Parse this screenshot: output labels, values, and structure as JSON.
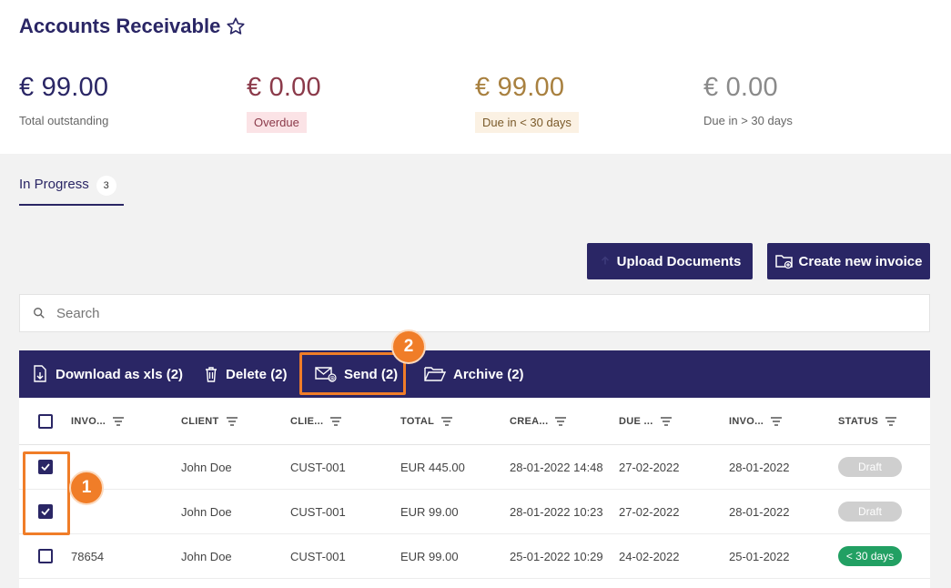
{
  "page": {
    "title": "Accounts Receivable"
  },
  "stats": [
    {
      "amount": "€ 99.00",
      "label": "Total outstanding",
      "color": "#2a2665"
    },
    {
      "amount": "€ 0.00",
      "label": "Overdue",
      "color": "#8b3a4a",
      "badge_bg": "#fbe3e6"
    },
    {
      "amount": "€ 99.00",
      "label": "Due in < 30 days",
      "color": "#a8803f",
      "badge_bg": "#fbf1e3"
    },
    {
      "amount": "€ 0.00",
      "label": "Due in > 30 days",
      "color": "#8a8a8a"
    }
  ],
  "tabs": [
    {
      "label": "In Progress",
      "count": "3"
    }
  ],
  "buttons": {
    "upload": "Upload Documents",
    "create": "Create new invoice"
  },
  "search": {
    "placeholder": "Search"
  },
  "actions": {
    "download": "Download as xls (2)",
    "delete": "Delete (2)",
    "send": "Send (2)",
    "archive": "Archive (2)"
  },
  "table": {
    "headers": [
      "INVO...",
      "CLIENT",
      "CLIE...",
      "TOTAL",
      "CREA...",
      "DUE ...",
      "INVO...",
      "STATUS"
    ],
    "rows": [
      {
        "checked": true,
        "invoice": "",
        "client": "John Doe",
        "client_id": "CUST-001",
        "total": "EUR 445.00",
        "created": "28-01-2022 14:48",
        "due": "27-02-2022",
        "invoice_date": "28-01-2022",
        "status": "Draft",
        "status_color": "#cfcfcf"
      },
      {
        "checked": true,
        "invoice": "",
        "client": "John Doe",
        "client_id": "CUST-001",
        "total": "EUR 99.00",
        "created": "28-01-2022 10:23",
        "due": "27-02-2022",
        "invoice_date": "28-01-2022",
        "status": "Draft",
        "status_color": "#cfcfcf"
      },
      {
        "checked": false,
        "invoice": "78654",
        "client": "John Doe",
        "client_id": "CUST-001",
        "total": "EUR 99.00",
        "created": "25-01-2022 10:29",
        "due": "24-02-2022",
        "invoice_date": "25-01-2022",
        "status": "< 30 days",
        "status_color": "#22a063"
      }
    ]
  },
  "annotations": {
    "one": "1",
    "two": "2",
    "color": "#f07d28"
  }
}
